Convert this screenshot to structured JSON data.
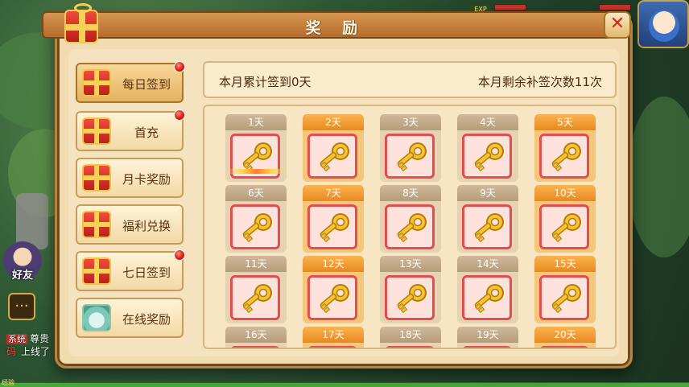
{
  "dialog": {
    "title": "奖 励",
    "close_label": "✕"
  },
  "menu": [
    {
      "label": "每日签到",
      "active": true,
      "badge": true,
      "icon": "gift-box-icon"
    },
    {
      "label": "首充",
      "active": false,
      "badge": true,
      "icon": "gift-box-icon"
    },
    {
      "label": "月卡奖励",
      "active": false,
      "badge": false,
      "icon": "gift-box-icon"
    },
    {
      "label": "福利兑换",
      "active": false,
      "badge": false,
      "icon": "gift-box-icon"
    },
    {
      "label": "七日签到",
      "active": false,
      "badge": true,
      "icon": "gift-box-icon"
    },
    {
      "label": "在线奖励",
      "active": false,
      "badge": false,
      "icon": "vase-icon"
    }
  ],
  "info": {
    "signed_text": "本月累计签到0天",
    "resign_text": "本月剩余补签次数11次"
  },
  "days": [
    {
      "label": "1天",
      "style": "grey"
    },
    {
      "label": "2天",
      "style": "orange"
    },
    {
      "label": "3天",
      "style": "grey"
    },
    {
      "label": "4天",
      "style": "grey"
    },
    {
      "label": "5天",
      "style": "orange"
    },
    {
      "label": "6天",
      "style": "grey"
    },
    {
      "label": "7天",
      "style": "orange"
    },
    {
      "label": "8天",
      "style": "grey"
    },
    {
      "label": "9天",
      "style": "grey"
    },
    {
      "label": "10天",
      "style": "orange"
    },
    {
      "label": "11天",
      "style": "grey"
    },
    {
      "label": "12天",
      "style": "orange"
    },
    {
      "label": "13天",
      "style": "grey"
    },
    {
      "label": "14天",
      "style": "grey"
    },
    {
      "label": "15天",
      "style": "orange"
    },
    {
      "label": "16天",
      "style": "grey"
    },
    {
      "label": "17天",
      "style": "orange"
    },
    {
      "label": "18天",
      "style": "grey"
    },
    {
      "label": "19天",
      "style": "grey"
    },
    {
      "label": "20天",
      "style": "orange"
    }
  ],
  "hud": {
    "exp_label": "EXP",
    "friend_label": "好友",
    "system_tag": "系统",
    "system_msg": "尊贵",
    "system_line2_red": "码",
    "system_line2": "上线了",
    "bottom_label": "经验"
  },
  "colors": {
    "panel_bg": "#f1dcb1",
    "title_bar": "#c27a34",
    "key_frame_border": "#e44d4e",
    "orange_header": "#f09a31",
    "grey_header": "#c2a987"
  }
}
